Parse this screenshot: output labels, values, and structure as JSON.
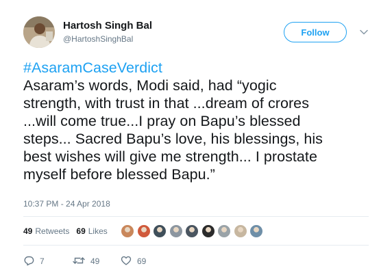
{
  "user": {
    "display_name": "Hartosh Singh Bal",
    "handle": "@HartoshSinghBal"
  },
  "follow_label": "Follow",
  "tweet": {
    "hashtag": "#AsaramCaseVerdict",
    "lines": [
      "Asaram’s words, Modi said, had “yogic",
      "strength, with trust in that ...dream of crores",
      "...will come true...I pray on Bapu’s blessed",
      "steps... Sacred Bapu’s love, his blessings, his",
      "best wishes will give me strength... I prostate",
      "myself before blessed Bapu.”"
    ],
    "timestamp": "10:37 PM - 24 Apr 2018"
  },
  "stats": {
    "retweets_count": "49",
    "retweets_label": "Retweets",
    "likes_count": "69",
    "likes_label": "Likes"
  },
  "likers": [
    {
      "color": "#c9875b"
    },
    {
      "color": "#d05a3c"
    },
    {
      "color": "#3f4f5a"
    },
    {
      "color": "#8c96a0"
    },
    {
      "color": "#4a5560"
    },
    {
      "color": "#2b2b2b"
    },
    {
      "color": "#9aa3a8"
    },
    {
      "color": "#c7b7a0"
    },
    {
      "color": "#6f8fa8"
    }
  ],
  "actions": {
    "reply_count": "7",
    "retweet_count": "49",
    "like_count": "69"
  },
  "colors": {
    "accent": "#1da1f2",
    "secondary_text": "#657786",
    "primary_text": "#14171a"
  },
  "icons": [
    "reply-icon",
    "retweet-icon",
    "heart-icon",
    "chevron-down-icon"
  ]
}
